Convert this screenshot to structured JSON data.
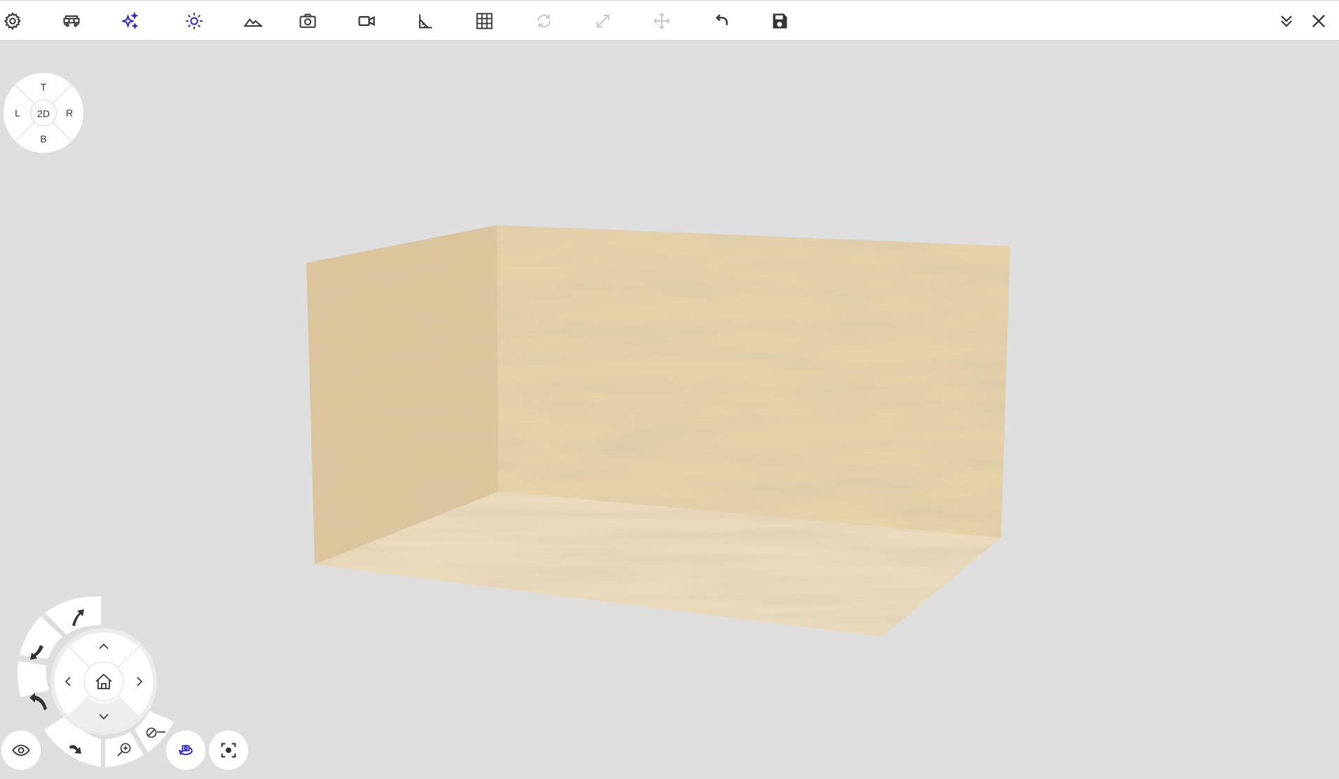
{
  "toolbar": {
    "items": [
      {
        "name": "settings",
        "icon": "gear-icon",
        "state": "normal"
      },
      {
        "name": "furniture",
        "icon": "sofa-icon",
        "state": "normal"
      },
      {
        "name": "effects",
        "icon": "sparkles-icon",
        "state": "active"
      },
      {
        "name": "lighting",
        "icon": "sun-icon",
        "state": "active"
      },
      {
        "name": "landscape",
        "icon": "mountain-icon",
        "state": "normal"
      },
      {
        "name": "snapshot",
        "icon": "camera-icon",
        "state": "normal"
      },
      {
        "name": "video",
        "icon": "video-camera-icon",
        "state": "normal"
      },
      {
        "name": "measure",
        "icon": "angle-ruler-icon",
        "state": "normal"
      },
      {
        "name": "grid",
        "icon": "grid-icon",
        "state": "normal"
      },
      {
        "name": "rotate",
        "icon": "rotate-icon",
        "state": "disabled"
      },
      {
        "name": "scale",
        "icon": "resize-arrows-icon",
        "state": "disabled"
      },
      {
        "name": "move",
        "icon": "move-arrows-icon",
        "state": "disabled"
      },
      {
        "name": "undo",
        "icon": "undo-icon",
        "state": "normal"
      },
      {
        "name": "save",
        "icon": "floppy-disk-icon",
        "state": "normal"
      }
    ],
    "collapse_icon": "double-chevron-down-icon",
    "close_icon": "close-icon"
  },
  "viewcube": {
    "top": "T",
    "left": "L",
    "right": "R",
    "bottom": "B",
    "center": "2D"
  },
  "navigation": {
    "buttons": [
      "tilt-up-arrow-icon",
      "turn-left-arrow-icon",
      "undo-turn-arrow-icon",
      "redo-turn-arrow-icon",
      "zoom-in-icon",
      "zoom-out-icon",
      "chevron-up-icon",
      "chevron-down-icon",
      "chevron-left-icon",
      "chevron-right-icon",
      "home-icon"
    ],
    "eye_icon": "eye-icon",
    "orbit_icon": "orbit-camera-icon",
    "focus_icon": "focus-frame-icon"
  },
  "colors": {
    "background": "#dedede",
    "toolbar": "#ffffff",
    "icon": "#333333",
    "icon_active": "#2424d6",
    "icon_disabled": "#c8c8c8",
    "wood_light": "#e3cfa6",
    "wood_dark": "#b69566"
  }
}
